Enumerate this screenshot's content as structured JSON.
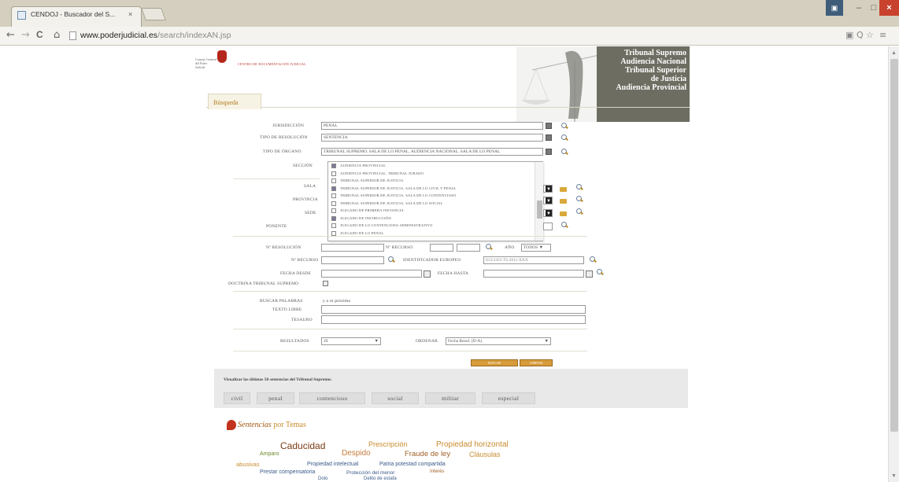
{
  "browser": {
    "tab_title": "CENDOJ - Buscador del S...",
    "tab_close": "×",
    "url_host": "www.poderjudicial.es",
    "url_path": "/search/indexAN.jsp",
    "nav": {
      "back": "←",
      "forward": "→",
      "reload": "C",
      "home": "⌂"
    },
    "window_buttons": {
      "app": "▣",
      "minimize": "–",
      "maximize": "□",
      "close": "×"
    },
    "toolbar_right": [
      "▣",
      "Q",
      "☆",
      "≡"
    ]
  },
  "header": {
    "court_lines": [
      "Tribunal Supremo",
      "Audiencia Nacional",
      "Tribunal Superior",
      "de Justicia",
      "Audiencia Provincial"
    ],
    "tab_label": "Búsqueda",
    "logo_text": "Consejo General del Poder Judicial",
    "logo_sub": "CENTRO DE DOCUMENTACIÓN JUDICIAL"
  },
  "form": {
    "jurisdiccion_label": "JURISDICCIÓN",
    "jurisdiccion_value": "PENAL",
    "tipo_resolucion_label": "TIPO DE RESOLUCIÓN",
    "tipo_resolucion_value": "SENTENCIA",
    "tipo_organo_label": "TIPO DE ÓRGANO",
    "tipo_organo_value": "TRIBUNAL SUPREMO. SALA DE LO PENAL, AUDIENCIA NACIONAL. SALA DE LO PENAL",
    "seccion_label": "SECCIÓN",
    "sala_label": "SALA",
    "provincia_label": "PROVINCIA",
    "sede_label": "SEDE",
    "ponente_label": "PONENTE",
    "numero_roj_label": "Nº RESOLUCIÓN",
    "numero_recurso_label": "Nº RECURSO",
    "ano_label": "AÑO",
    "ano_value": "TODOS",
    "ecli_label": "IDENTIFICADOR EUROPEO",
    "ecli_value": "ECLI:ES:TS:2011:XXX",
    "fecha_desde_label": "FECHA DESDE",
    "fecha_hasta_label": "FECHA HASTA",
    "doctrina_label": "DOCTRINA TRIBUNAL SUPREMO",
    "buscar_palabras_label": "BUSCAR PALABRAS",
    "busqueda_value": "y  o  ni  próximo",
    "texto_libre_label": "TEXTO LIBRE",
    "tesauro_label": "TESAURO",
    "resultados_label": "RESULTADOS",
    "resultados_value": "20",
    "ordenar_label": "ORDENAR",
    "ordenar_value": "Fecha Resol. (D-A)",
    "btn_search": "BUSCAR",
    "btn_clear": "LIMPIAR",
    "select_arrow": "▼"
  },
  "seccion_options": [
    {
      "label": "AUDIENCIA PROVINCIAL",
      "checked": true
    },
    {
      "label": "AUDIENCIA PROVINCIAL. TRIBUNAL JURADO",
      "checked": false
    },
    {
      "label": "TRIBUNAL SUPERIOR DE JUSTICIA",
      "checked": false
    },
    {
      "label": "TRIBUNAL SUPERIOR DE JUSTICIA. SALA DE LO CIVIL Y PENAL",
      "checked": true
    },
    {
      "label": "TRIBUNAL SUPERIOR DE JUSTICIA. SALA DE LO CONTENCIOSO",
      "checked": false
    },
    {
      "label": "TRIBUNAL SUPERIOR DE JUSTICIA. SALA DE LO SOCIAL",
      "checked": false
    },
    {
      "label": "JUZGADO DE PRIMERA INSTANCIA",
      "checked": false
    },
    {
      "label": "JUZGADO DE INSTRUCCIÓN",
      "checked": true
    },
    {
      "label": "JUZGADO DE LO CONTENCIOSO ADMINISTRATIVO",
      "checked": false
    },
    {
      "label": "JUZGADO DE LO PENAL",
      "checked": false
    }
  ],
  "ultimas": {
    "title": "Visualizar las últimas 50 sentencias del Tribunal Supremo:",
    "buttons": [
      "civil",
      "penal",
      "contencioso",
      "social",
      "militar",
      "especial"
    ]
  },
  "sentencias": {
    "heading_prefix": "Sentencias",
    "heading_suffix": "por Temas",
    "tags": [
      {
        "text": "Caducidad",
        "color": "#7a3a14",
        "size": 12
      },
      {
        "text": "Prescripción",
        "color": "#c98c2e",
        "size": 9
      },
      {
        "text": "Propiedad horizontal",
        "color": "#c98c2e",
        "size": 10
      },
      {
        "text": "Amparo",
        "color": "#6a8a2a",
        "size": 7
      },
      {
        "text": "Despido",
        "color": "#c97a3a",
        "size": 10
      },
      {
        "text": "Fraude de ley",
        "color": "#a0602a",
        "size": 9.5
      },
      {
        "text": "Cláusulas",
        "color": "#c98c2e",
        "size": 9
      },
      {
        "text": "abusivas",
        "color": "#c98c2e",
        "size": 7.5
      },
      {
        "text": "Propiedad intelectual",
        "color": "#3a5a8a",
        "size": 7
      },
      {
        "text": "Patria potestad compartida",
        "color": "#3a5a8a",
        "size": 7
      },
      {
        "text": "Prestar compensatoria",
        "color": "#3a5a8a",
        "size": 7
      },
      {
        "text": "Protección del menor",
        "color": "#3a5a8a",
        "size": 6.5
      },
      {
        "text": "Interés",
        "color": "#a0602a",
        "size": 6
      },
      {
        "text": "Dolo",
        "color": "#3a5a8a",
        "size": 6
      },
      {
        "text": "Delito de estafa",
        "color": "#3a5a8a",
        "size": 6
      }
    ]
  },
  "colors": {
    "court_block": "#6e6d62",
    "accent": "#b27b1e",
    "button": "#d69b3a"
  }
}
